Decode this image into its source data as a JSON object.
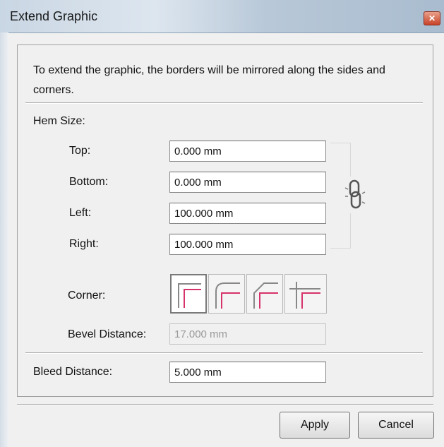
{
  "window": {
    "title": "Extend Graphic"
  },
  "description": "To extend the graphic, the borders will be mirrored along the sides and corners.",
  "hem_size": {
    "label": "Hem Size:",
    "top": {
      "label": "Top:",
      "value": "0.000 mm"
    },
    "bottom": {
      "label": "Bottom:",
      "value": "0.000 mm"
    },
    "left": {
      "label": "Left:",
      "value": "100.000 mm"
    },
    "right": {
      "label": "Right:",
      "value": "100.000 mm"
    }
  },
  "corner": {
    "label": "Corner:",
    "options": [
      "corner-square-icon",
      "corner-round-icon",
      "corner-bevel-icon",
      "corner-overlap-icon"
    ],
    "selected_index": 0
  },
  "bevel_distance": {
    "label": "Bevel Distance:",
    "value": "17.000 mm"
  },
  "bleed_distance": {
    "label": "Bleed Distance:",
    "value": "5.000 mm"
  },
  "buttons": {
    "apply": "Apply",
    "cancel": "Cancel"
  },
  "colors": {
    "accent": "#d6336c"
  }
}
